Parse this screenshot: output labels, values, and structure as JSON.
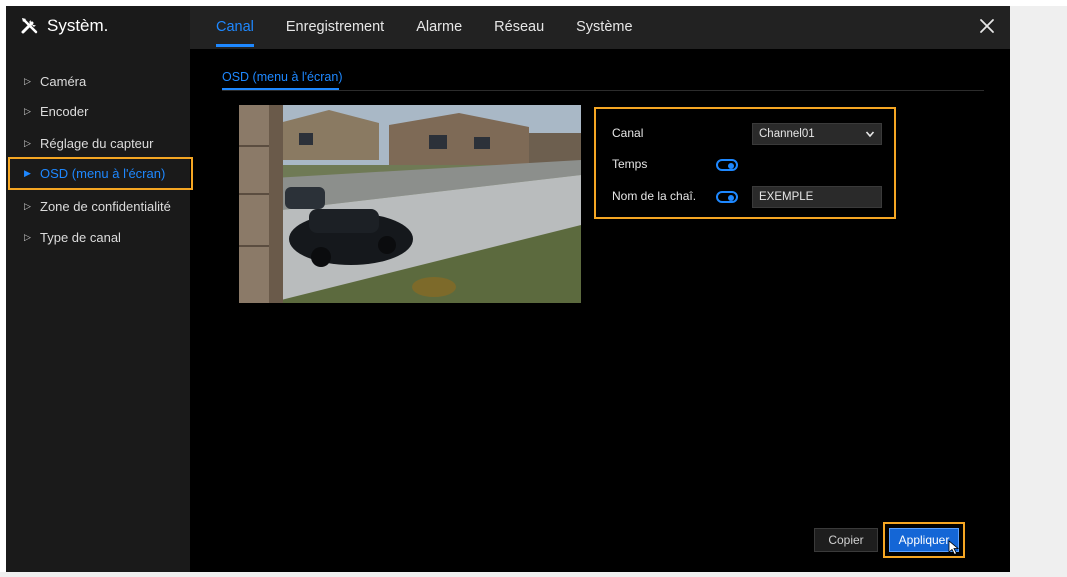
{
  "app": {
    "title": "Systèm."
  },
  "tabs": [
    {
      "label": "Canal",
      "active": true
    },
    {
      "label": "Enregistrement"
    },
    {
      "label": "Alarme"
    },
    {
      "label": "Réseau"
    },
    {
      "label": "Système"
    }
  ],
  "sidebar": {
    "items": [
      {
        "label": "Caméra"
      },
      {
        "label": "Encoder"
      },
      {
        "label": "Réglage du capteur"
      },
      {
        "label": "OSD (menu à l'écran)",
        "active": true
      },
      {
        "label": "Zone de confidentialité"
      },
      {
        "label": "Type de canal"
      }
    ]
  },
  "content": {
    "subtab": "OSD (menu à l'écran)"
  },
  "osd": {
    "channel_label": "Canal",
    "channel_value": "Channel01",
    "time_label": "Temps",
    "time_enabled": true,
    "name_label": "Nom de la chaî.",
    "name_enabled": true,
    "name_value": "EXEMPLE"
  },
  "buttons": {
    "copy": "Copier",
    "apply": "Appliquer"
  },
  "colors": {
    "accent": "#1e88ff",
    "highlight": "#f5a623",
    "background": "#000000"
  }
}
